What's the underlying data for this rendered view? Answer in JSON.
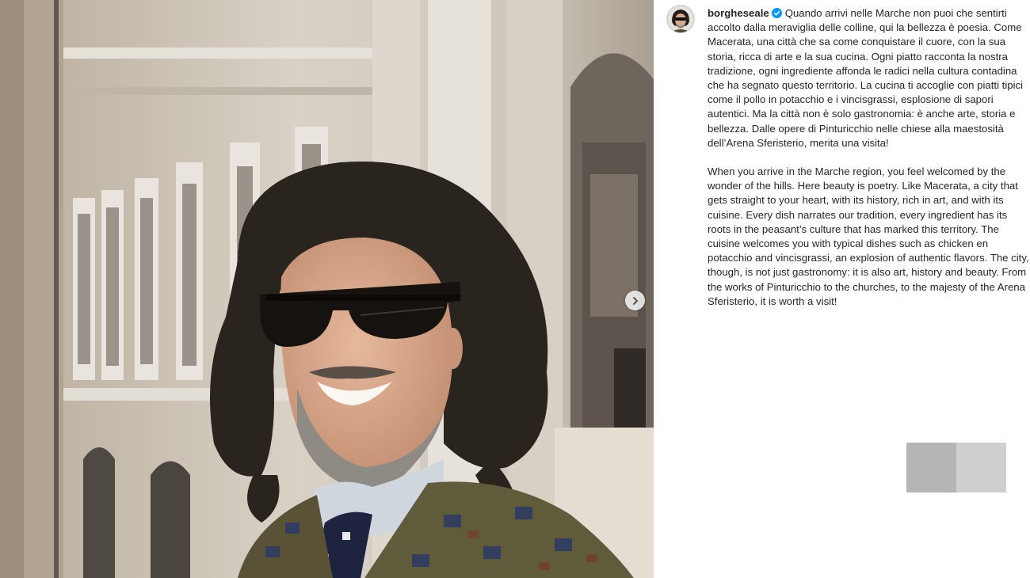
{
  "post": {
    "username": "borgheseale",
    "verified_icon": "verified-badge-icon",
    "caption_it": "Quando arrivi nelle Marche non puoi che sentirti accolto dalla meraviglia delle colline, qui la bellezza è poesia. Come Macerata, una città che sa come conquistare il cuore, con la sua storia, ricca di arte e la sua cucina. Ogni piatto racconta la nostra tradizione, ogni ingrediente affonda le radici nella cultura contadina che ha segnato questo territorio. La cucina ti accoglie con piatti tipici come il pollo in potacchio e i vincisgrassi, esplosione di sapori autentici. Ma la città non è solo gastronomia: è anche arte, storia e bellezza. Dalle opere di Pinturicchio nelle chiese alla maestosità dell’Arena Sferisterio, merita una visita!",
    "caption_en": "When you arrive in the Marche region, you feel welcomed by the wonder of the hills. Here beauty is poetry. Like Macerata, a city that gets straight to your heart, with its history, rich in art, and with its cuisine. Every dish narrates our tradition, every ingredient has its roots in the peasant’s culture that has marked this territory. The cuisine welcomes you with typical dishes such as chicken en potacchio and vincisgrassi, an explosion of authentic flavors. The city, though, is not just gastronomy: it is also art, history and beauty. From the works of Pinturicchio to the churches, to the majesty of the Arena Sferisterio, it is worth a visit!"
  },
  "carousel": {
    "next_icon": "chevron-right-icon"
  },
  "colors": {
    "text": "#262626",
    "verified": "#0095f6",
    "placeholder_dark": "#b5b5b5",
    "placeholder_light": "#cfcfcf"
  }
}
